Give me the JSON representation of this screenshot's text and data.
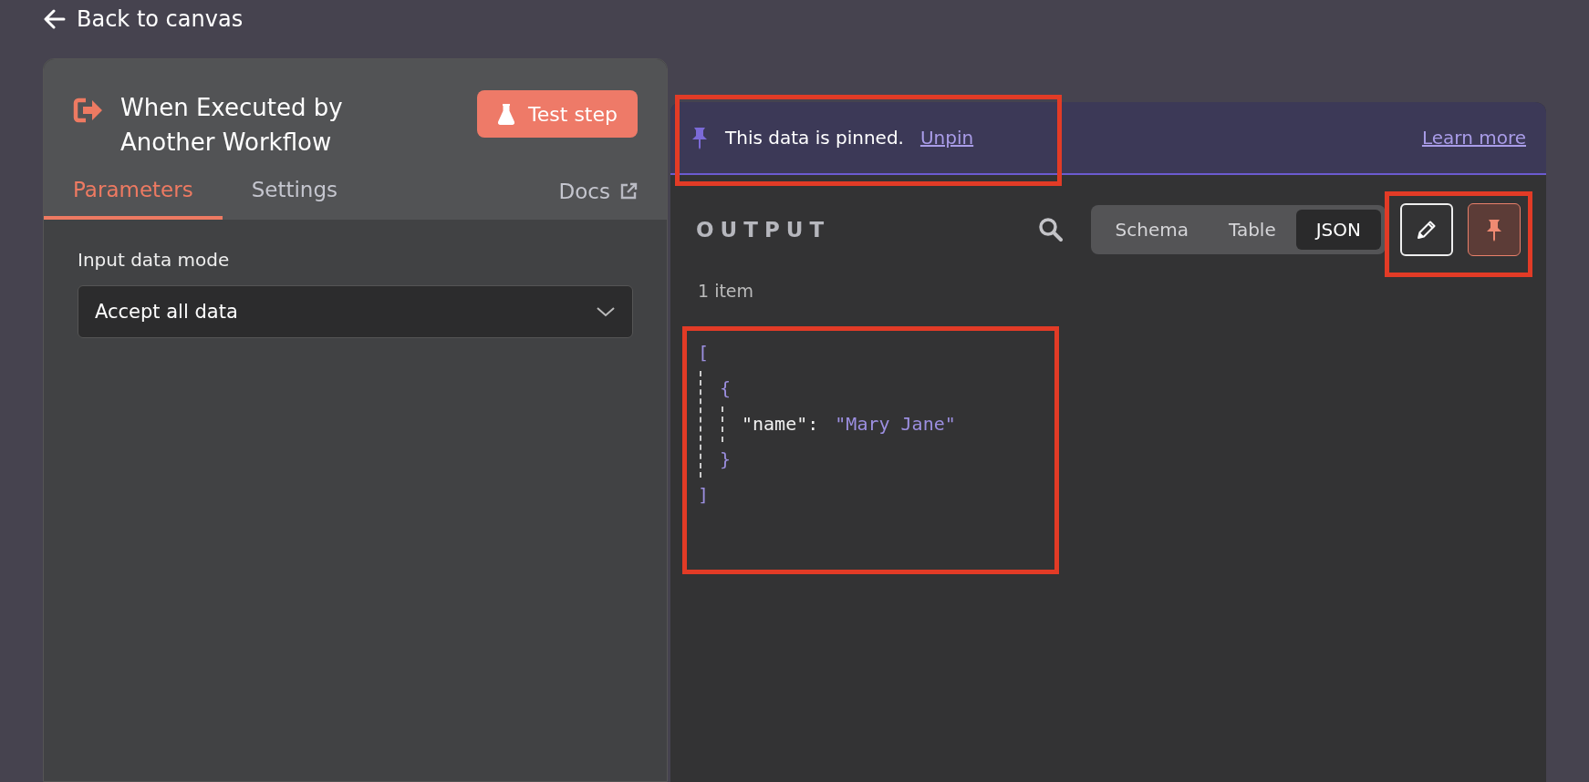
{
  "back_link": "Back to canvas",
  "node": {
    "title": "When Executed by Another Workflow",
    "test_button": "Test step"
  },
  "tabs": [
    {
      "label": "Parameters",
      "selected": true
    },
    {
      "label": "Settings",
      "selected": false
    }
  ],
  "docs_link": "Docs",
  "parameters": [
    {
      "label": "Input data mode",
      "value": "Accept all data"
    }
  ],
  "output": {
    "banner": {
      "message": "This data is pinned.",
      "unpin_link": "Unpin",
      "learn_more_link": "Learn more"
    },
    "title": "OUTPUT",
    "view_tabs": [
      {
        "label": "Schema",
        "selected": false
      },
      {
        "label": "Table",
        "selected": false
      },
      {
        "label": "JSON",
        "selected": true
      }
    ],
    "pinned": true,
    "item_count": "1 item",
    "json_view": {
      "open": "[",
      "close": "]",
      "children": [
        {
          "open": "{",
          "close": "}",
          "children": [
            {
              "key": "\"name\":",
              "value": "\"Mary Jane\""
            }
          ]
        }
      ]
    }
  }
}
